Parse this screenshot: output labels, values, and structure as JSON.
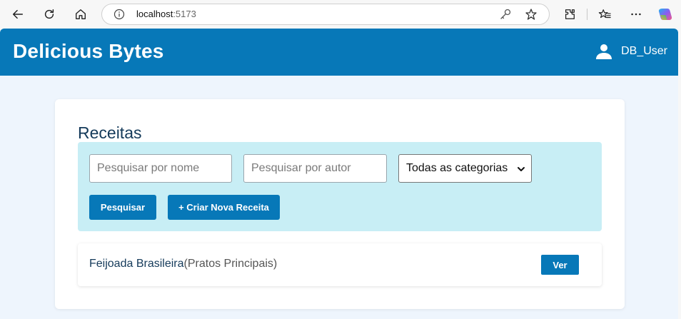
{
  "browser": {
    "url": "localhost:5173",
    "url_host": "localhost",
    "url_port": ":5173"
  },
  "header": {
    "app_title": "Delicious Bytes",
    "user_name": "DB_User",
    "brand_color": "#0778b8"
  },
  "main": {
    "title": "Receitas",
    "filters": {
      "name_placeholder": "Pesquisar por nome",
      "name_value": "",
      "author_placeholder": "Pesquisar por autor",
      "author_value": "",
      "category_selected": "Todas as categorias"
    },
    "buttons": {
      "search_label": "Pesquisar",
      "create_label": "+ Criar Nova Receita"
    },
    "recipes": [
      {
        "name": "Feijoada Brasileira",
        "category": "(Pratos Principais)",
        "view_label": "Ver"
      }
    ]
  },
  "icons": {
    "back": "back-arrow-icon",
    "refresh": "refresh-icon",
    "home": "home-icon",
    "info": "info-icon",
    "key": "key-icon",
    "favorite": "star-icon",
    "extensions": "puzzle-icon",
    "favorites_bar": "favorites-icon",
    "more": "more-icon",
    "copilot": "copilot-icon",
    "user": "user-icon"
  }
}
